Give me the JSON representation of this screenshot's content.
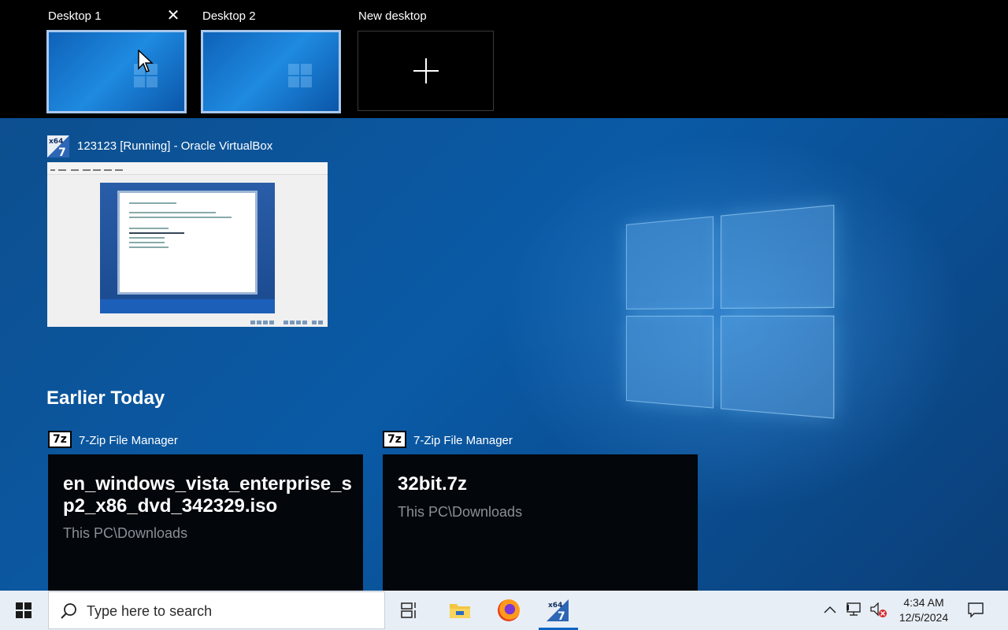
{
  "task_view": {
    "desktops": [
      {
        "label": "Desktop 1",
        "close_glyph": "✕",
        "close_icon": "close-icon"
      },
      {
        "label": "Desktop 2"
      }
    ],
    "new_desktop": {
      "label": "New desktop",
      "icon": "plus-icon"
    }
  },
  "open_windows": [
    {
      "app_icon": "virtualbox-icon",
      "title": "123123 [Running] - Oracle VirtualBox"
    }
  ],
  "timeline": {
    "section_title": "Earlier Today",
    "cards": [
      {
        "app_icon_text": "7z",
        "app_name": "7-Zip File Manager",
        "file_name": "en_windows_vista_enterprise_sp2_x86_dvd_342329.iso",
        "path": "This PC\\Downloads"
      },
      {
        "app_icon_text": "7z",
        "app_name": "7-Zip File Manager",
        "file_name": "32bit.7z",
        "path": "This PC\\Downloads"
      }
    ]
  },
  "taskbar": {
    "search_placeholder": "Type here to search",
    "pinned": [
      "windows-start-icon",
      "task-view-icon",
      "file-explorer-icon",
      "firefox-icon",
      "virtualbox-icon"
    ],
    "active_app": "virtualbox-icon",
    "clock": {
      "time": "4:34 AM",
      "date": "12/5/2024"
    },
    "tray_icons": [
      "chevron-up-icon",
      "network-icon",
      "volume-muted-icon",
      "notification-icon"
    ]
  },
  "colors": {
    "accent": "#0a66c2",
    "desktop_border": "#aac8ee",
    "taskbar_bg": "#e8eef6"
  }
}
